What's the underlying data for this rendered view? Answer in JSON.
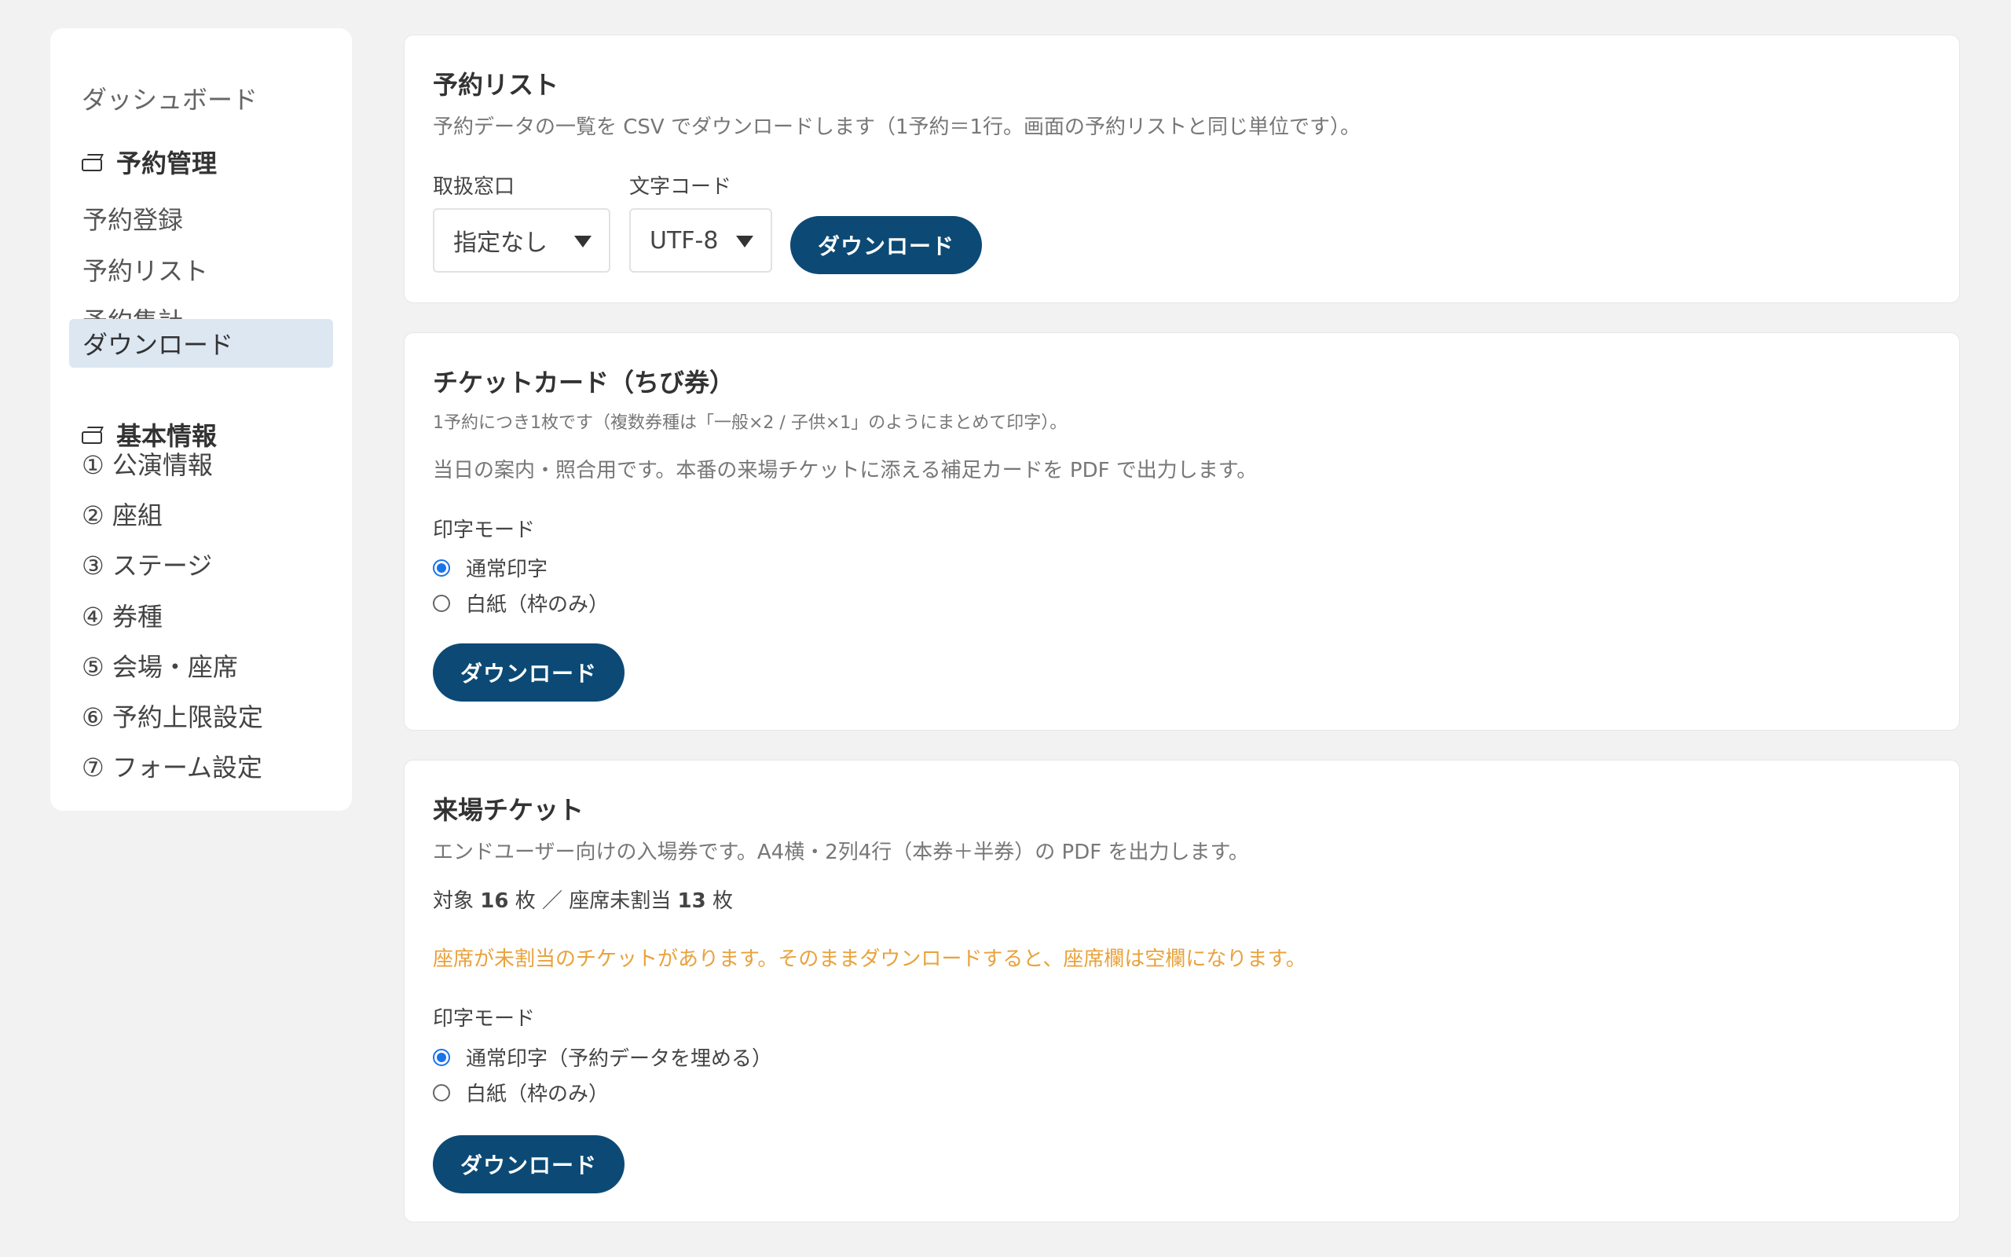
{
  "sidebar": {
    "dashboard": "ダッシュボード",
    "section_reservation": "予約管理",
    "reservation_items": [
      "予約登録",
      "予約リスト",
      "予約集計",
      "ダウンロード"
    ],
    "section_basic": "基本情報",
    "basic_items": [
      "① 公演情報",
      "② 座組",
      "③ ステージ",
      "④ 券種",
      "⑤ 会場・座席",
      "⑥ 予約上限設定",
      "⑦ フォーム設定"
    ]
  },
  "reservation_list": {
    "title": "予約リスト",
    "description": "予約データの一覧を CSV でダウンロードします（1予約＝1行。画面の予約リストと同じ単位です）。",
    "counter_label": "取扱窓口",
    "counter_value": "指定なし",
    "encoding_label": "文字コード",
    "encoding_value": "UTF-8",
    "download": "ダウンロード"
  },
  "ticket_card": {
    "title": "チケットカード（ちび券）",
    "note": "1予約につき1枚です（複数券種は「一般×2 / 子供×1」のようにまとめて印字）。",
    "description": "当日の案内・照合用です。本番の来場チケットに添える補足カードを PDF で出力します。",
    "print_mode_label": "印字モード",
    "options": [
      "通常印字",
      "白紙（枠のみ）"
    ],
    "download": "ダウンロード"
  },
  "entry_ticket": {
    "title": "来場チケット",
    "description": "エンドユーザー向けの入場券です。A4横・2列4行（本券＋半券）の PDF を出力します。",
    "count_prefix": "対象",
    "count_total": "16",
    "count_unit1": "枚 ／ 座席未割当",
    "count_unassigned": "13",
    "count_unit2": "枚",
    "warning": "座席が未割当のチケットがあります。そのままダウンロードすると、座席欄は空欄になります。",
    "print_mode_label": "印字モード",
    "options": [
      "通常印字（予約データを埋める）",
      "白紙（枠のみ）"
    ],
    "download": "ダウンロード"
  },
  "colors": {
    "primary_button": "#0c4a75",
    "active_nav": "#dde7f2",
    "warning": "#e9a23b",
    "radio_checked": "#1a73e8"
  }
}
